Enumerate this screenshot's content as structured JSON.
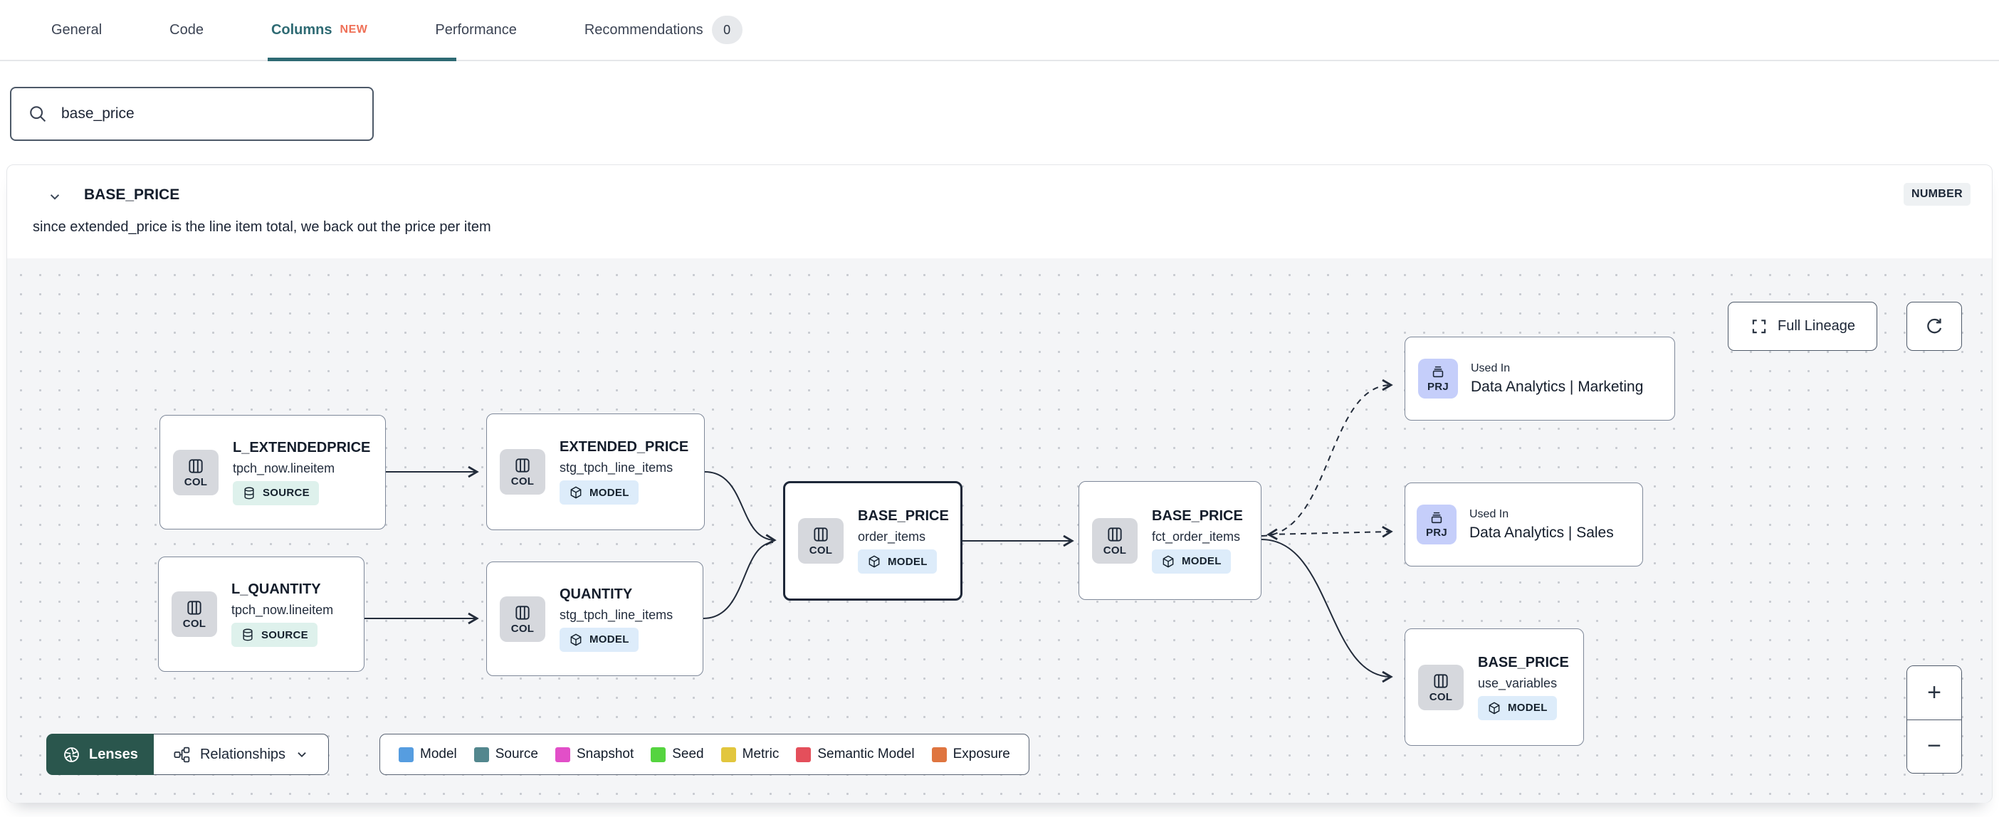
{
  "tabs": {
    "items": [
      {
        "label": "General",
        "active": false
      },
      {
        "label": "Code",
        "active": false
      },
      {
        "label": "Columns",
        "badge": "NEW",
        "active": true
      },
      {
        "label": "Performance",
        "active": false
      },
      {
        "label": "Recommendations",
        "count": "0",
        "active": false
      }
    ]
  },
  "search": {
    "value": "base_price"
  },
  "column_panel": {
    "title": "BASE_PRICE",
    "type_badge": "NUMBER",
    "description": "since extended_price is the line item total, we back out the price per item"
  },
  "lineage": {
    "full_lineage_label": "Full Lineage",
    "lenses_label": "Lenses",
    "relationships_label": "Relationships",
    "zoom_in_label": "+",
    "zoom_out_label": "−",
    "nodes": [
      {
        "chip": "COL",
        "title": "L_EXTENDEDPRICE",
        "subtitle": "tpch_now.lineitem",
        "badge": "SOURCE",
        "type": "source"
      },
      {
        "chip": "COL",
        "title": "EXTENDED_PRICE",
        "subtitle": "stg_tpch_line_items",
        "badge": "MODEL",
        "type": "model"
      },
      {
        "chip": "COL",
        "title": "L_QUANTITY",
        "subtitle": "tpch_now.lineitem",
        "badge": "SOURCE",
        "type": "source"
      },
      {
        "chip": "COL",
        "title": "QUANTITY",
        "subtitle": "stg_tpch_line_items",
        "badge": "MODEL",
        "type": "model"
      },
      {
        "chip": "COL",
        "title": "BASE_PRICE",
        "subtitle": "order_items",
        "badge": "MODEL",
        "type": "model",
        "selected": true
      },
      {
        "chip": "COL",
        "title": "BASE_PRICE",
        "subtitle": "fct_order_items",
        "badge": "MODEL",
        "type": "model"
      },
      {
        "chip": "PRJ",
        "eyebrow": "Used In",
        "title": "Data Analytics | Marketing",
        "type": "project"
      },
      {
        "chip": "PRJ",
        "eyebrow": "Used In",
        "title": "Data Analytics | Sales",
        "type": "project"
      },
      {
        "chip": "COL",
        "title": "BASE_PRICE",
        "subtitle": "use_variables",
        "badge": "MODEL",
        "type": "model"
      }
    ],
    "legend": {
      "items": [
        {
          "label": "Model",
          "color": "#569de0"
        },
        {
          "label": "Source",
          "color": "#53878e"
        },
        {
          "label": "Snapshot",
          "color": "#e24fc8"
        },
        {
          "label": "Seed",
          "color": "#55d43f"
        },
        {
          "label": "Metric",
          "color": "#e2c63e"
        },
        {
          "label": "Semantic Model",
          "color": "#e44f5b"
        },
        {
          "label": "Exposure",
          "color": "#df7540"
        }
      ]
    }
  },
  "colors": {
    "active_tab": "#2e6a73",
    "new_badge": "#ef7057",
    "lenses_bg": "#2a564d",
    "selected_node_border": "#1d2738"
  }
}
